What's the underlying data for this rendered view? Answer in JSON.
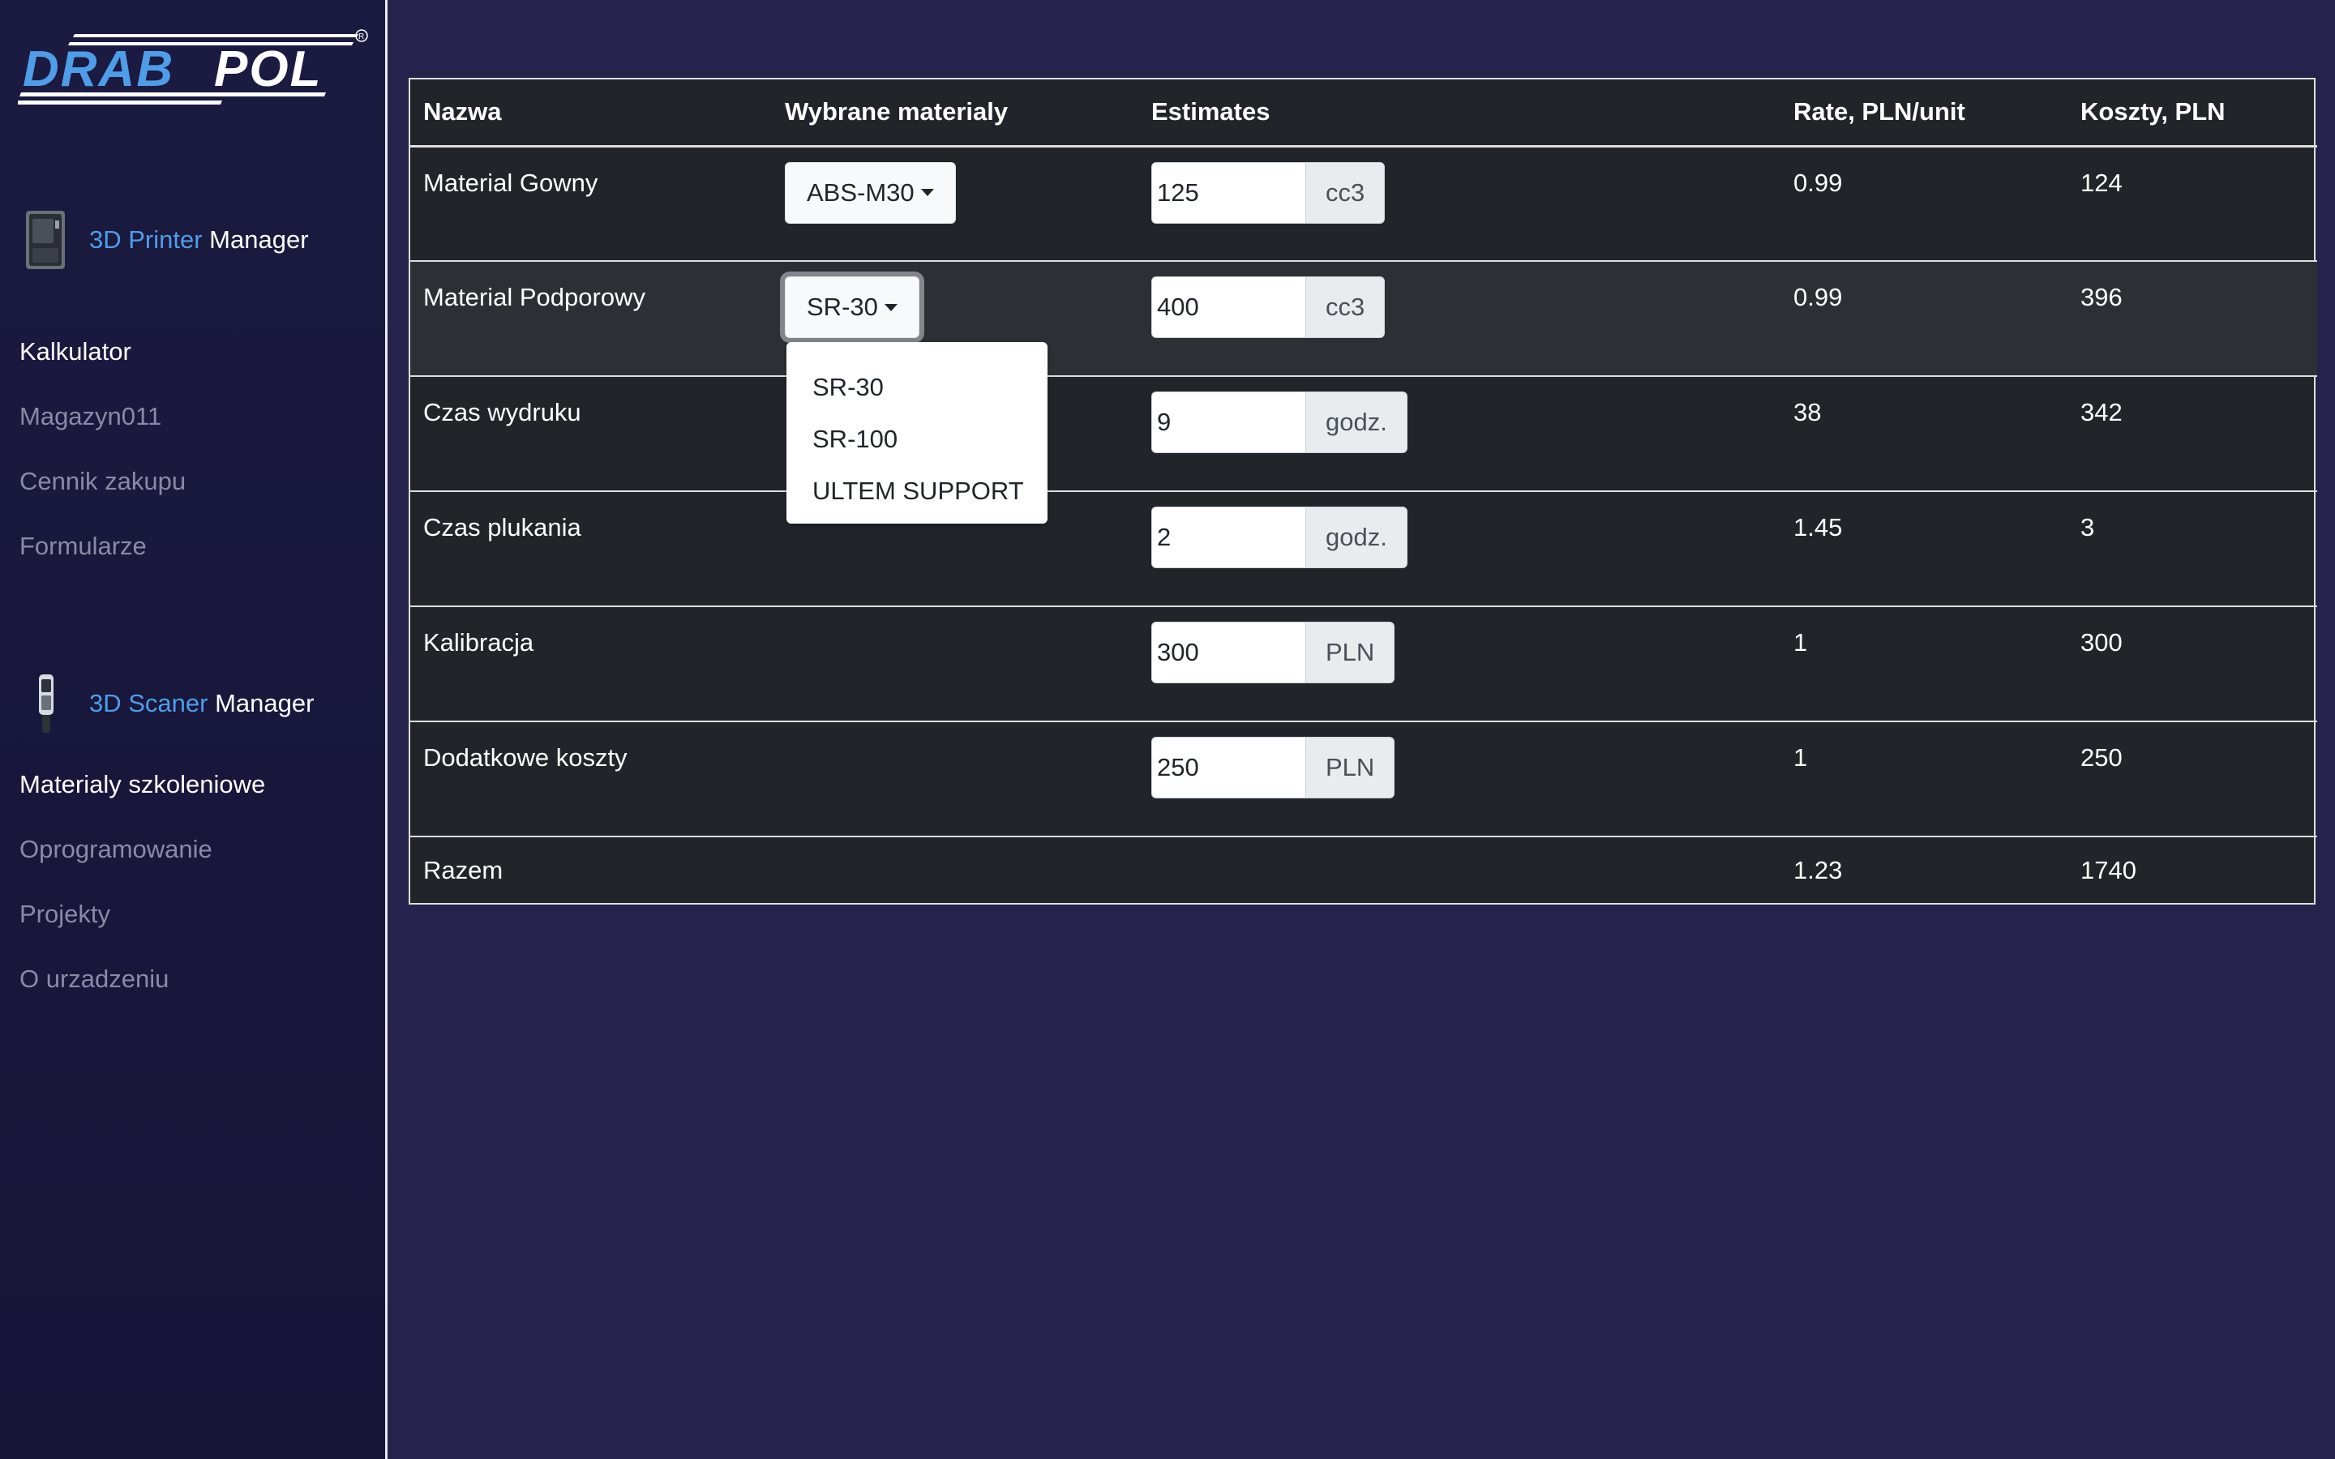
{
  "brand": {
    "logo_text": "DRAB POL",
    "registered_mark": "®"
  },
  "sidebar": {
    "printer": {
      "title_highlight": "3D Printer",
      "title_rest": "Manager",
      "icon": "3d-printer-icon"
    },
    "printer_links": [
      "Kalkulator",
      "Magazyn011",
      "Cennik zakupu",
      "Formularze"
    ],
    "scanner": {
      "title_highlight": "3D Scaner",
      "title_rest": "Manager",
      "icon": "3d-scanner-icon"
    },
    "scanner_links": [
      "Materialy szkoleniowe",
      "Oprogramowanie",
      "Projekty",
      "O urzadzeniu"
    ]
  },
  "table": {
    "headers": [
      "Nazwa",
      "Wybrane materialy",
      "Estimates",
      "Rate, PLN/unit",
      "Koszty, PLN"
    ],
    "rows": [
      {
        "name": "Material Gowny",
        "material": "ABS-M30",
        "estimate": "125",
        "unit": "cc3",
        "rate": "0.99",
        "cost": "124"
      },
      {
        "name": "Material Podporowy",
        "material": "SR-30",
        "estimate": "400",
        "unit": "cc3",
        "rate": "0.99",
        "cost": "396"
      },
      {
        "name": "Czas wydruku",
        "estimate": "9",
        "unit": "godz.",
        "rate": "38",
        "cost": "342"
      },
      {
        "name": "Czas plukania",
        "estimate": "2",
        "unit": "godz.",
        "rate": "1.45",
        "cost": "3"
      },
      {
        "name": "Kalibracja",
        "estimate": "300",
        "unit": "PLN",
        "rate": "1",
        "cost": "300"
      },
      {
        "name": "Dodatkowe koszty",
        "estimate": "250",
        "unit": "PLN",
        "rate": "1",
        "cost": "250"
      }
    ],
    "total": {
      "name": "Razem",
      "rate": "1.23",
      "cost": "1740"
    }
  },
  "dropdown": {
    "options": [
      "SR-30",
      "SR-100",
      "ULTEM SUPPORT"
    ]
  },
  "colors": {
    "accent": "#4f9de8",
    "background": "#25224b",
    "sidebar": "#1b1a40",
    "table": "#212529"
  }
}
